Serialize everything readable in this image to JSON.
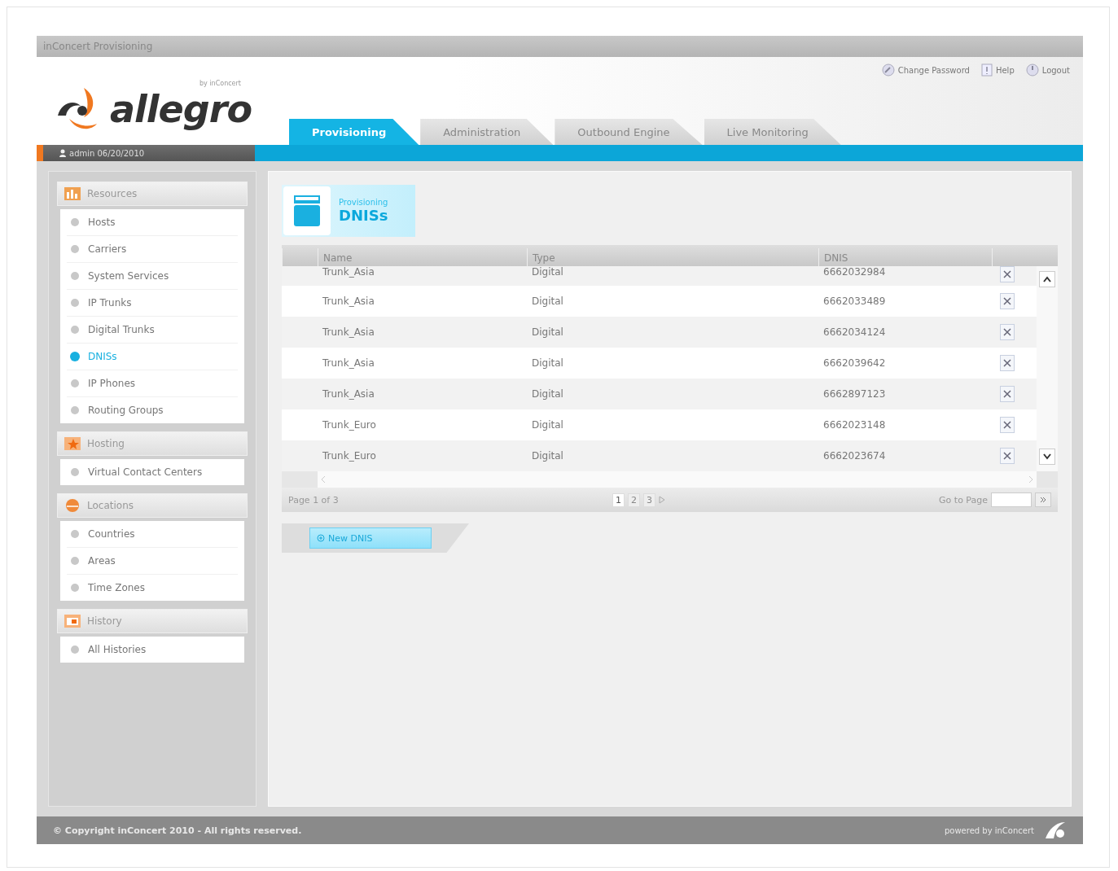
{
  "window": {
    "title": "inConcert Provisioning"
  },
  "logo": {
    "name": "allegro",
    "byline": "by inConcert"
  },
  "header_links": [
    {
      "label": "Change Password"
    },
    {
      "label": "Help"
    },
    {
      "label": "Logout"
    }
  ],
  "tabs": [
    {
      "label": "Provisioning",
      "selected": true
    },
    {
      "label": "Administration",
      "selected": false
    },
    {
      "label": "Outbound Engine",
      "selected": false
    },
    {
      "label": "Live Monitoring",
      "selected": false
    }
  ],
  "user": "admin 06/20/2010",
  "sidebar": {
    "groups": [
      {
        "title": "Resources",
        "items": [
          {
            "label": "Hosts",
            "selected": false
          },
          {
            "label": "Carriers",
            "selected": false
          },
          {
            "label": "System Services",
            "selected": false
          },
          {
            "label": "IP Trunks",
            "selected": false
          },
          {
            "label": "Digital Trunks",
            "selected": false
          },
          {
            "label": "DNISs",
            "selected": true
          },
          {
            "label": "IP Phones",
            "selected": false
          },
          {
            "label": "Routing Groups",
            "selected": false
          }
        ]
      },
      {
        "title": "Hosting",
        "items": [
          {
            "label": "Virtual Contact Centers",
            "selected": false
          }
        ]
      },
      {
        "title": "Locations",
        "items": [
          {
            "label": "Countries",
            "selected": false
          },
          {
            "label": "Areas",
            "selected": false
          },
          {
            "label": "Time Zones",
            "selected": false
          }
        ]
      },
      {
        "title": "History",
        "items": [
          {
            "label": "All Histories",
            "selected": false
          }
        ]
      }
    ]
  },
  "page_header": {
    "section": "Provisioning",
    "title": "DNISs"
  },
  "table": {
    "columns": [
      "Name",
      "Type",
      "DNIS"
    ],
    "rows": [
      {
        "name": "Trunk_Asia",
        "type": "Digital",
        "dnis": "6662032984"
      },
      {
        "name": "Trunk_Asia",
        "type": "Digital",
        "dnis": "6662033489"
      },
      {
        "name": "Trunk_Asia",
        "type": "Digital",
        "dnis": "6662034124"
      },
      {
        "name": "Trunk_Asia",
        "type": "Digital",
        "dnis": "6662039642"
      },
      {
        "name": "Trunk_Asia",
        "type": "Digital",
        "dnis": "6662897123"
      },
      {
        "name": "Trunk_Euro",
        "type": "Digital",
        "dnis": "6662023148"
      },
      {
        "name": "Trunk_Euro",
        "type": "Digital",
        "dnis": "6662023674"
      }
    ]
  },
  "pager": {
    "summary": "Page 1 of 3",
    "pages": [
      {
        "label": "1",
        "selected": true
      },
      {
        "label": "2",
        "selected": false
      },
      {
        "label": "3",
        "selected": false
      }
    ],
    "goto_label": "Go to Page"
  },
  "new_button": "New DNIS",
  "footer": {
    "copyright": "© Copyright inConcert 2010 - All rights reserved.",
    "powered": "powered by inConcert"
  }
}
